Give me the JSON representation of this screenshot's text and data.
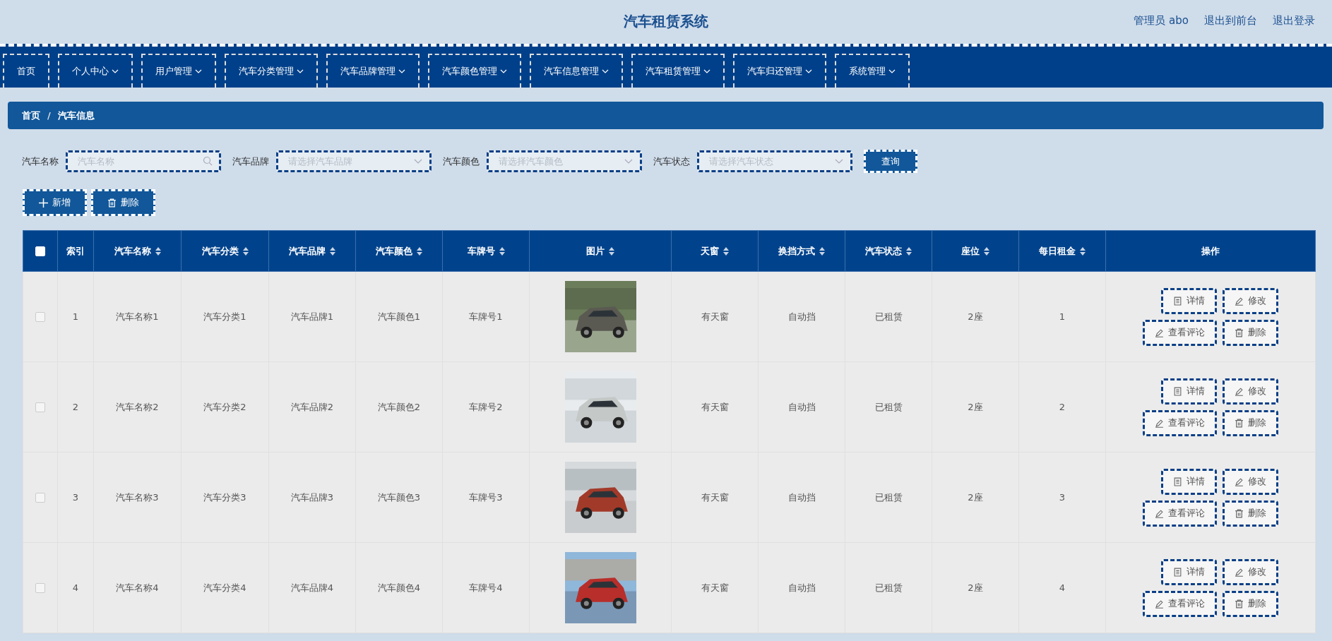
{
  "header": {
    "title": "汽车租赁系统",
    "links": [
      "管理员 abo",
      "退出到前台",
      "退出登录"
    ]
  },
  "nav": [
    {
      "label": "首页",
      "dropdown": false
    },
    {
      "label": "个人中心",
      "dropdown": true
    },
    {
      "label": "用户管理",
      "dropdown": true
    },
    {
      "label": "汽车分类管理",
      "dropdown": true
    },
    {
      "label": "汽车品牌管理",
      "dropdown": true
    },
    {
      "label": "汽车颜色管理",
      "dropdown": true
    },
    {
      "label": "汽车信息管理",
      "dropdown": true
    },
    {
      "label": "汽车租赁管理",
      "dropdown": true
    },
    {
      "label": "汽车归还管理",
      "dropdown": true
    },
    {
      "label": "系统管理",
      "dropdown": true
    }
  ],
  "breadcrumb": {
    "items": [
      "首页",
      "汽车信息"
    ],
    "separator": "/"
  },
  "filters": [
    {
      "label": "汽车名称",
      "placeholder": "汽车名称",
      "kind": "search"
    },
    {
      "label": "汽车品牌",
      "placeholder": "请选择汽车品牌",
      "kind": "select"
    },
    {
      "label": "汽车颜色",
      "placeholder": "请选择汽车颜色",
      "kind": "select"
    },
    {
      "label": "汽车状态",
      "placeholder": "请选择汽车状态",
      "kind": "select"
    }
  ],
  "search_button": "查询",
  "toolbar": [
    {
      "label": "新增",
      "kind": "add"
    },
    {
      "label": "删除",
      "kind": "delete"
    }
  ],
  "table": {
    "select_all": {
      "checked": false
    },
    "columns": [
      {
        "label": "索引",
        "sortable": false
      },
      {
        "label": "汽车名称",
        "sortable": true
      },
      {
        "label": "汽车分类",
        "sortable": true
      },
      {
        "label": "汽车品牌",
        "sortable": true
      },
      {
        "label": "汽车颜色",
        "sortable": true
      },
      {
        "label": "车牌号",
        "sortable": true
      },
      {
        "label": "图片",
        "sortable": true
      },
      {
        "label": "天窗",
        "sortable": true
      },
      {
        "label": "换挡方式",
        "sortable": true
      },
      {
        "label": "汽车状态",
        "sortable": true
      },
      {
        "label": "座位",
        "sortable": true
      },
      {
        "label": "每日租金",
        "sortable": true
      },
      {
        "label": "操作",
        "sortable": false
      }
    ],
    "rows": [
      {
        "checked": false,
        "cells": [
          "1",
          "汽车名称1",
          "汽车分类1",
          "汽车品牌1",
          "汽车颜色1",
          "车牌号1",
          {
            "kind": "picture"
          },
          "有天窗",
          "自动挡",
          "已租赁",
          "2座",
          "1"
        ],
        "actions": [
          {
            "label": "详情",
            "kind": "detail"
          },
          {
            "label": "修改",
            "kind": "edit"
          },
          {
            "label": "查看评论",
            "kind": "edit"
          },
          {
            "label": "删除",
            "kind": "delete"
          }
        ]
      },
      {
        "checked": false,
        "cells": [
          "2",
          "汽车名称2",
          "汽车分类2",
          "汽车品牌2",
          "汽车颜色2",
          "车牌号2",
          {
            "kind": "picture"
          },
          "有天窗",
          "自动挡",
          "已租赁",
          "2座",
          "2"
        ],
        "actions": [
          {
            "label": "详情",
            "kind": "detail"
          },
          {
            "label": "修改",
            "kind": "edit"
          },
          {
            "label": "查看评论",
            "kind": "edit"
          },
          {
            "label": "删除",
            "kind": "delete"
          }
        ]
      },
      {
        "checked": false,
        "cells": [
          "3",
          "汽车名称3",
          "汽车分类3",
          "汽车品牌3",
          "汽车颜色3",
          "车牌号3",
          {
            "kind": "picture"
          },
          "有天窗",
          "自动挡",
          "已租赁",
          "2座",
          "3"
        ],
        "actions": [
          {
            "label": "详情",
            "kind": "detail"
          },
          {
            "label": "修改",
            "kind": "edit"
          },
          {
            "label": "查看评论",
            "kind": "edit"
          },
          {
            "label": "删除",
            "kind": "delete"
          }
        ]
      },
      {
        "checked": false,
        "cells": [
          "4",
          "汽车名称4",
          "汽车分类4",
          "汽车品牌4",
          "汽车颜色4",
          "车牌号4",
          {
            "kind": "picture"
          },
          "有天窗",
          "自动挡",
          "已租赁",
          "2座",
          "4"
        ],
        "actions": [
          {
            "label": "详情",
            "kind": "detail"
          },
          {
            "label": "修改",
            "kind": "edit"
          },
          {
            "label": "查看评论",
            "kind": "edit"
          },
          {
            "label": "删除",
            "kind": "delete"
          }
        ]
      }
    ]
  }
}
